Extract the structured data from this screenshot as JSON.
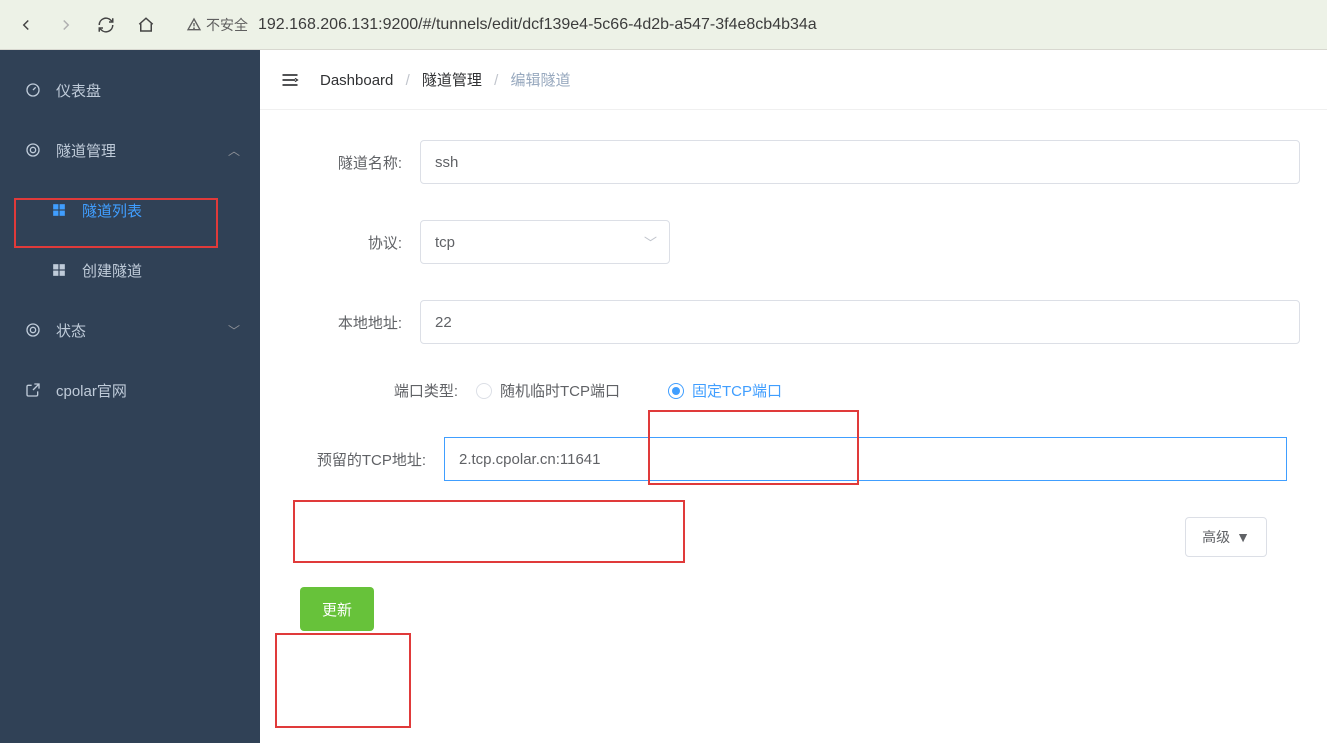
{
  "browser": {
    "insecure_label": "不安全",
    "url": "192.168.206.131:9200/#/tunnels/edit/dcf139e4-5c66-4d2b-a547-3f4e8cb4b34a"
  },
  "sidebar": {
    "items": [
      {
        "label": "仪表盘"
      },
      {
        "label": "隧道管理"
      },
      {
        "label": "隧道列表"
      },
      {
        "label": "创建隧道"
      },
      {
        "label": "状态"
      },
      {
        "label": "cpolar官网"
      }
    ]
  },
  "breadcrumb": {
    "c1": "Dashboard",
    "c2": "隧道管理",
    "c3": "编辑隧道"
  },
  "form": {
    "name_label": "隧道名称:",
    "name_value": "ssh",
    "proto_label": "协议:",
    "proto_value": "tcp",
    "addr_label": "本地地址:",
    "addr_value": "22",
    "port_type_label": "端口类型:",
    "port_opt1": "随机临时TCP端口",
    "port_opt2": "固定TCP端口",
    "tcp_addr_label": "预留的TCP地址:",
    "tcp_addr_value": "2.tcp.cpolar.cn:11641",
    "advanced_label": "高级",
    "submit_label": "更新"
  }
}
